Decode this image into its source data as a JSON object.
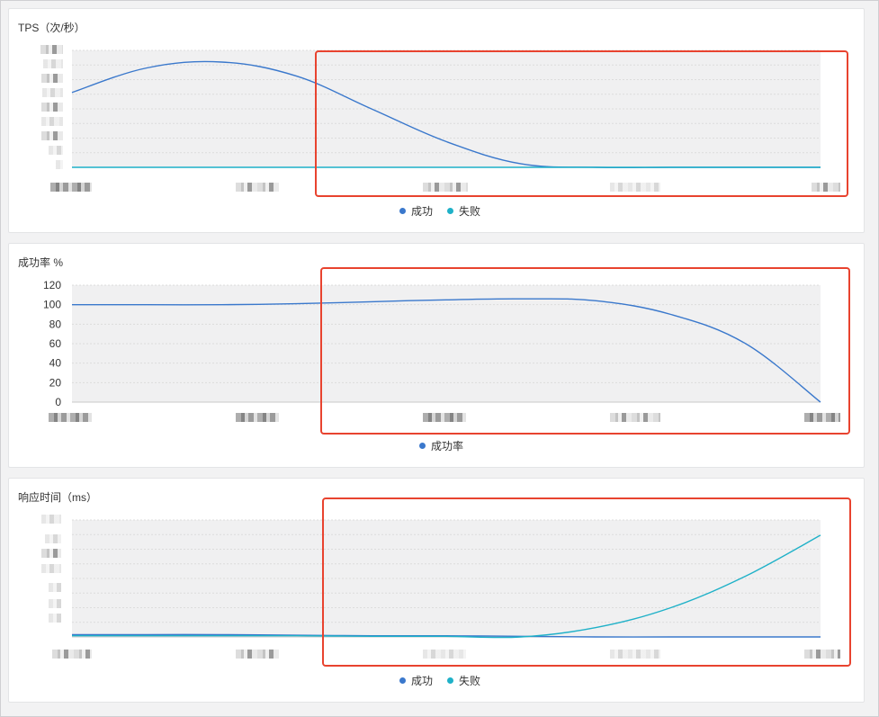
{
  "colors": {
    "success": "#3a78cc",
    "failure": "#1fb1c8",
    "plot_bg": "#f0f0f1",
    "grid": "#dcdcdc",
    "highlight": "#e8432f"
  },
  "panels": [
    {
      "title": "TPS（次/秒）",
      "legend": [
        "成功",
        "失败"
      ]
    },
    {
      "title": "成功率 %",
      "legend": [
        "成功率"
      ]
    },
    {
      "title": "响应时间（ms）",
      "legend": [
        "成功",
        "失败"
      ]
    }
  ],
  "chart_data": [
    {
      "type": "line",
      "title": "TPS（次/秒）",
      "x": [
        0,
        0.1,
        0.2,
        0.3,
        0.4,
        0.5,
        0.6,
        0.7,
        0.8,
        0.9,
        1.0
      ],
      "ylim": [
        0,
        1
      ],
      "series": [
        {
          "name": "成功",
          "values": [
            0.64,
            0.85,
            0.9,
            0.78,
            0.5,
            0.22,
            0.03,
            0,
            0,
            0,
            0
          ]
        },
        {
          "name": "失败",
          "values": [
            0,
            0,
            0,
            0,
            0,
            0,
            0,
            0,
            0,
            0,
            0
          ]
        }
      ]
    },
    {
      "type": "line",
      "title": "成功率 %",
      "y_ticks": [
        "0",
        "20",
        "40",
        "60",
        "80",
        "100",
        "120"
      ],
      "ylim": [
        0,
        120
      ],
      "x": [
        0,
        0.1,
        0.2,
        0.3,
        0.4,
        0.5,
        0.6,
        0.7,
        0.8,
        0.9,
        1.0
      ],
      "series": [
        {
          "name": "成功率",
          "values": [
            100,
            100,
            100,
            101,
            103,
            105,
            106,
            104,
            90,
            60,
            0
          ]
        }
      ]
    },
    {
      "type": "line",
      "title": "响应时间（ms）",
      "x": [
        0,
        0.1,
        0.2,
        0.3,
        0.4,
        0.5,
        0.6,
        0.7,
        0.8,
        0.9,
        1.0
      ],
      "ylim": [
        0,
        1
      ],
      "series": [
        {
          "name": "成功",
          "values": [
            0.02,
            0.02,
            0.02,
            0.015,
            0.01,
            0.01,
            0.005,
            0,
            0,
            0,
            0
          ]
        },
        {
          "name": "失败",
          "values": [
            0.01,
            0.01,
            0.01,
            0.01,
            0.005,
            0.005,
            0,
            0.08,
            0.25,
            0.52,
            0.87
          ]
        }
      ]
    }
  ]
}
